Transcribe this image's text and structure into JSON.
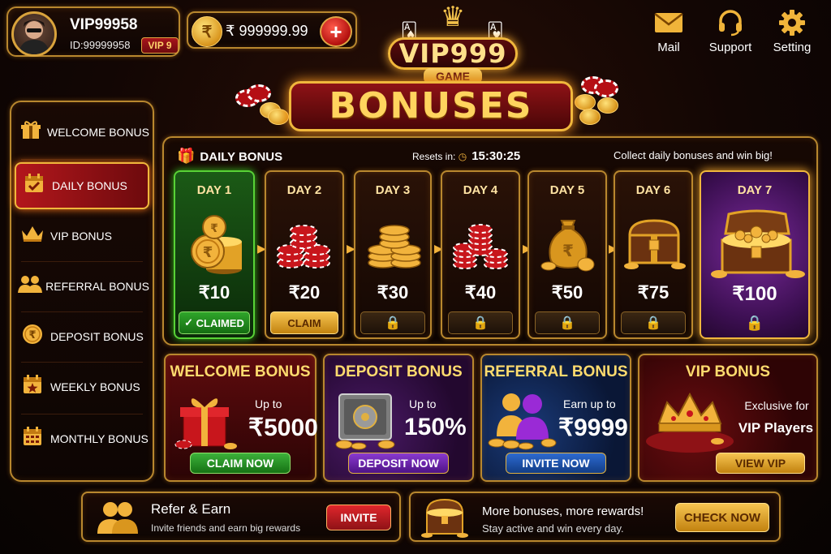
{
  "user": {
    "name": "VIP99958",
    "id": "ID:99999958",
    "vip": "VIP 9"
  },
  "wallet": {
    "symbol": "₹",
    "balance": "₹ 999999.99",
    "add": "+"
  },
  "top_nav": [
    {
      "label": "Mail",
      "icon": "mail-icon"
    },
    {
      "label": "Support",
      "icon": "headset-icon"
    },
    {
      "label": "Setting",
      "icon": "gear-icon"
    }
  ],
  "logo": {
    "main": "VIP999",
    "sub": "GAME"
  },
  "page_title": "BONUSES",
  "sidebar": {
    "items": [
      {
        "label": "WELCOME BONUS",
        "icon": "gift-icon",
        "active": false
      },
      {
        "label": "DAILY BONUS",
        "icon": "calendar-check-icon",
        "active": true
      },
      {
        "label": "VIP BONUS",
        "icon": "crown-icon",
        "active": false
      },
      {
        "label": "REFERRAL BONUS",
        "icon": "users-icon",
        "active": false
      },
      {
        "label": "DEPOSIT BONUS",
        "icon": "rupee-coin-icon",
        "active": false
      },
      {
        "label": "WEEKLY BONUS",
        "icon": "calendar-star-icon",
        "active": false
      },
      {
        "label": "MONTHLY BONUS",
        "icon": "calendar-grid-icon",
        "active": false
      }
    ]
  },
  "daily": {
    "title": "DAILY BONUS",
    "resets_label": "Resets in:",
    "resets_time": "15:30:25",
    "tagline": "Collect daily bonuses and win big!",
    "days": [
      {
        "label": "DAY 1",
        "amount": "₹10",
        "state": "CLAIMED",
        "img": "gold-coins-icon"
      },
      {
        "label": "DAY 2",
        "amount": "₹20",
        "state": "CLAIM",
        "img": "casino-chips-icon"
      },
      {
        "label": "DAY 3",
        "amount": "₹30",
        "state": "locked",
        "img": "coin-stack-icon"
      },
      {
        "label": "DAY 4",
        "amount": "₹40",
        "state": "locked",
        "img": "chip-stacks-icon"
      },
      {
        "label": "DAY 5",
        "amount": "₹50",
        "state": "locked",
        "img": "money-bag-icon"
      },
      {
        "label": "DAY 6",
        "amount": "₹75",
        "state": "locked",
        "img": "treasure-chest-icon"
      },
      {
        "label": "DAY 7",
        "amount": "₹100",
        "state": "locked",
        "img": "open-treasure-chest-icon"
      }
    ]
  },
  "promos": [
    {
      "title": "WELCOME BONUS",
      "line1": "Up to",
      "big": "₹5000",
      "button": "CLAIM NOW",
      "img": "gift-box-icon"
    },
    {
      "title": "DEPOSIT BONUS",
      "line1": "Up to",
      "big": "150%",
      "button": "DEPOSIT NOW",
      "img": "safe-icon"
    },
    {
      "title": "REFERRAL BONUS",
      "line1": "Earn up to",
      "big": "₹9999",
      "button": "INVITE NOW",
      "img": "users-icon"
    },
    {
      "title": "VIP BONUS",
      "line1": "Exclusive for",
      "line2": "VIP Players",
      "button": "VIEW VIP",
      "img": "crown-icon"
    }
  ],
  "footer": {
    "refer": {
      "title": "Refer & Earn",
      "sub": "Invite friends and earn big rewards",
      "button": "INVITE"
    },
    "more": {
      "title": "More bonuses, more rewards!",
      "sub": "Stay active and win every day.",
      "button": "CHECK NOW"
    }
  }
}
